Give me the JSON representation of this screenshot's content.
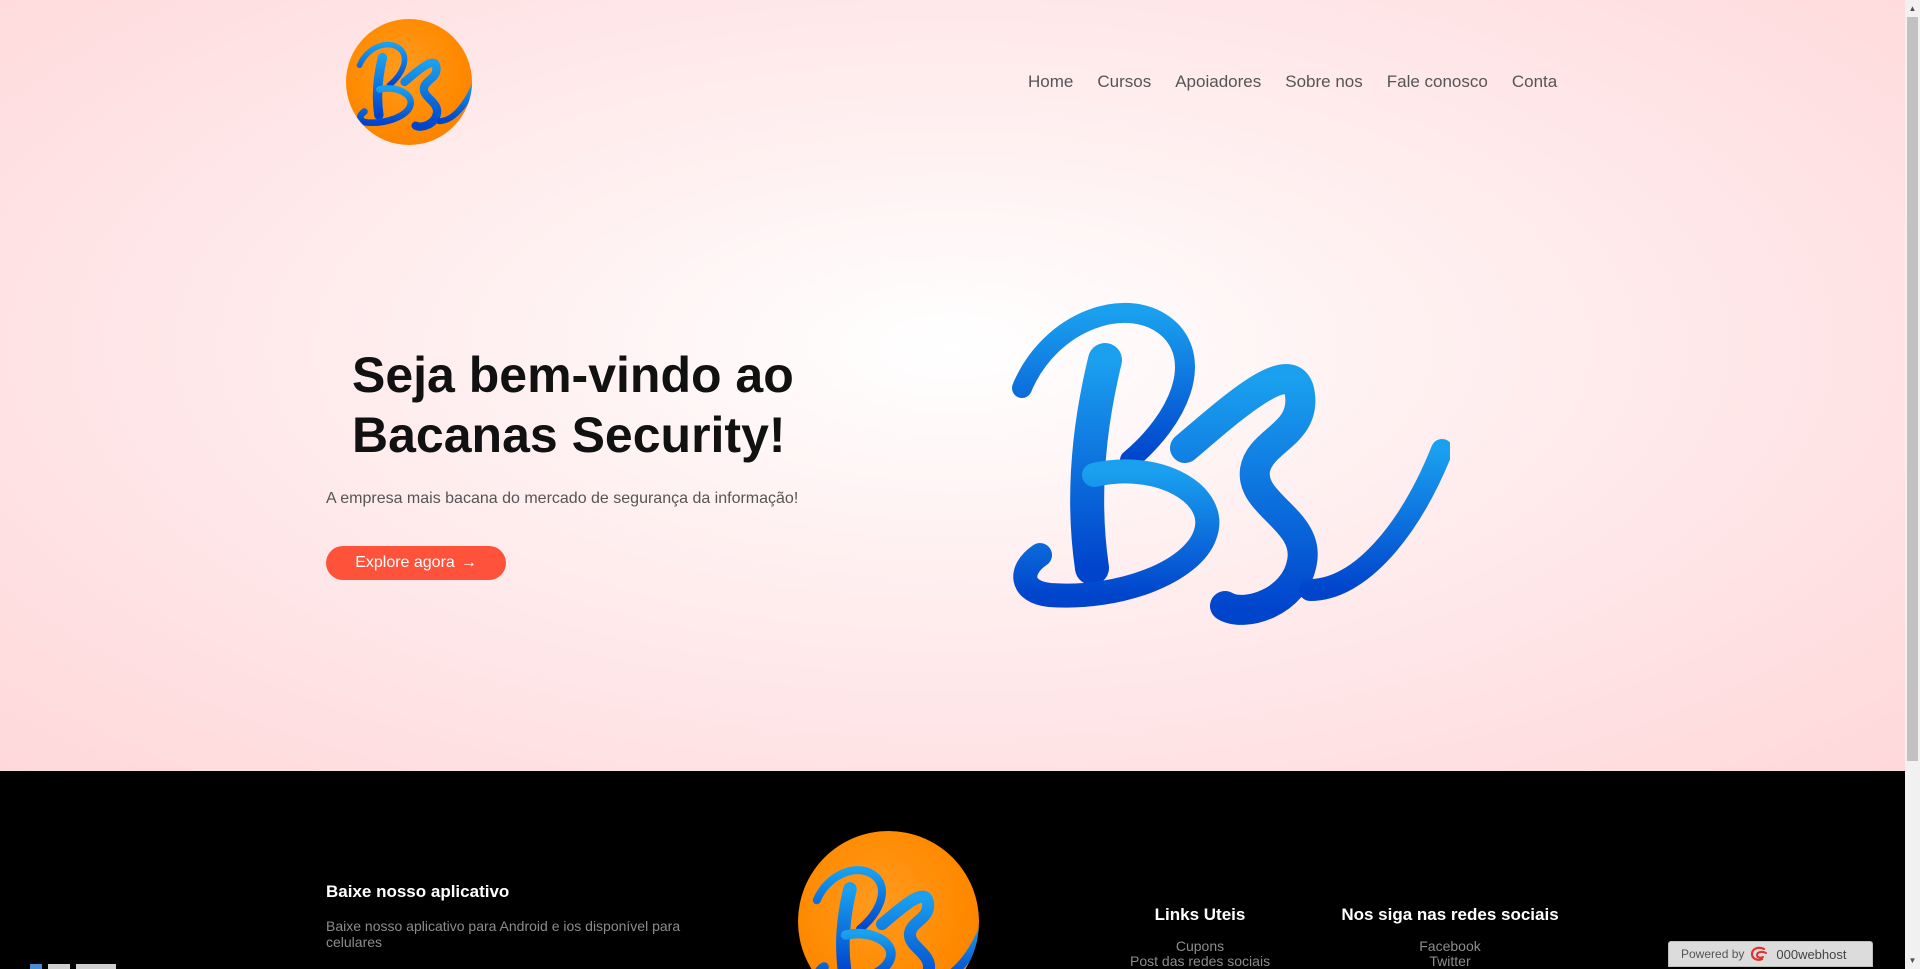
{
  "nav": {
    "items": [
      {
        "label": "Home"
      },
      {
        "label": "Cursos"
      },
      {
        "label": "Apoiadores"
      },
      {
        "label": "Sobre nos"
      },
      {
        "label": "Fale conosco"
      },
      {
        "label": "Conta"
      }
    ]
  },
  "hero": {
    "title": "Seja bem-vindo ao Bacanas Security!",
    "subtitle": "A empresa mais bacana do mercado de segurança da informação!",
    "cta_label": "Explore agora",
    "cta_arrow": "→"
  },
  "footer": {
    "app": {
      "heading": "Baixe nosso aplicativo",
      "text": "Baixe nosso aplicativo para Android e ios disponível para celulares"
    },
    "links": {
      "heading": "Links Uteis",
      "items": [
        "Cupons",
        "Post das redes sociais"
      ]
    },
    "social": {
      "heading": "Nos siga nas redes sociais",
      "items": [
        "Facebook",
        "Twitter"
      ]
    }
  },
  "powered": {
    "prefix": "Powered by",
    "brand": "000webhost"
  },
  "colors": {
    "accent": "#ff523b",
    "logo_orange": "#ff8a00",
    "logo_blue": "#0a63d8"
  },
  "icons": {
    "logo": "bs-logo-icon",
    "powered_logo": "webhost-logo-icon"
  }
}
